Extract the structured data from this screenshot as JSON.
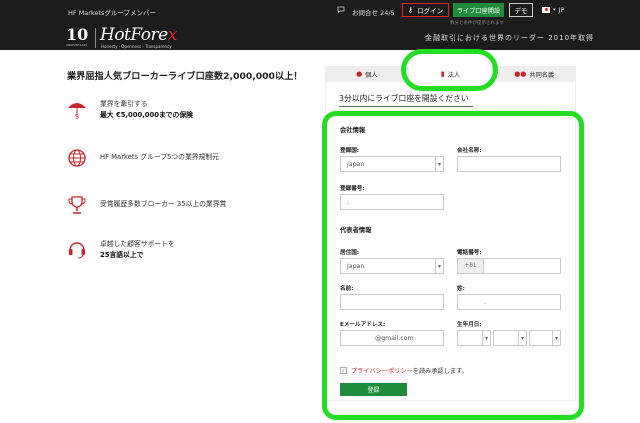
{
  "header": {
    "member_text": "HF Marketsグループメンバー",
    "inquiry": "お問合せ 24/5",
    "login_label": "ログイン",
    "live_account_label": "ライブ口座開設",
    "live_account_sub": "数分と条件が提示されます",
    "demo_label": "デモ",
    "lang_label": "JP",
    "logo_10": "10",
    "logo_10_sub": "ANNIVERSARY",
    "logo_main": "HotFore",
    "logo_x": "x",
    "logo_tagline": "Honesty · Openness · Transparency",
    "leader_text": "金融取引における世界のリーダー 2010年取得"
  },
  "left": {
    "headline": "業界屈指人気ブローカーライブ口座数2,000,000以上！",
    "features": [
      {
        "icon": "umbrella-dollar-icon",
        "line1": "業界を牽引する",
        "line2": "最大 €5,000,000までの保険"
      },
      {
        "icon": "globe-icon",
        "line1": "HF Markets グループ5つの業界規制元",
        "line2": ""
      },
      {
        "icon": "trophy-icon",
        "line1": "受賞履歴多数ブローカー 35以上の業界賞",
        "line2": ""
      },
      {
        "icon": "headset-icon",
        "line1": "卓越した顧客サポートを",
        "line2": "25言語以上で"
      }
    ]
  },
  "form": {
    "tabs": [
      {
        "label": "個人",
        "icon": "person-icon"
      },
      {
        "label": "法人",
        "icon": "building-icon"
      },
      {
        "label": "共同名義",
        "icon": "group-icon"
      }
    ],
    "active_tab": "法人",
    "title": "3分以内にライブ口座を開設ください",
    "company_section": "会社情報",
    "country_label": "登録国:",
    "country_value": "Japan",
    "company_name_label": "会社名称:",
    "company_name_value": "",
    "reg_number_label": "登録番号:",
    "reg_number_value": ":",
    "rep_section": "代表者情報",
    "residence_label": "居住国:",
    "residence_value": "Japan",
    "phone_label": "電話番号:",
    "phone_prefix": "+81",
    "phone_value": "",
    "first_name_label": "名前:",
    "first_name_value": "",
    "last_name_label": "姓:",
    "last_name_value": ".",
    "email_label": "Eメールアドレス:",
    "email_value": "@gmail.com",
    "dob_label": "生年月日:",
    "dob_day": "",
    "dob_month": "",
    "dob_year": "",
    "policy_link": "プライバシーポリシー",
    "policy_text": "を読み承認します。",
    "submit_label": "登録"
  },
  "colors": {
    "accent_red": "#c9232b",
    "green": "#1e8c3a",
    "highlight": "#22dd22",
    "header_bg": "#1c1c1c"
  }
}
